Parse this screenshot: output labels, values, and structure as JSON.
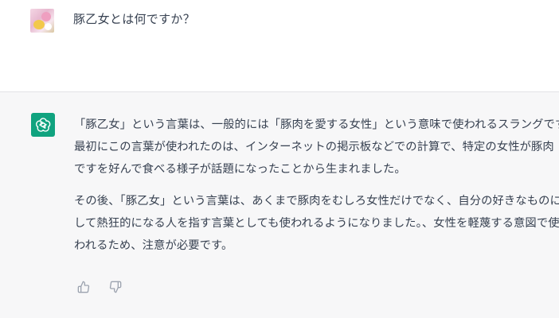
{
  "user_message": {
    "text": "豚乙女とは何ですか？"
  },
  "assistant_message": {
    "paragraphs": [
      {
        "lines": [
          "「豚乙女」という言葉は、一般的には「豚肉を愛する女性」という意味で使われるスラングです。",
          "最初にこの言葉が使われたのは、インターネットの掲示板などでの計算で、特定の女性が豚肉",
          "ですを好んで食べる様子が話題になったことから生まれました。"
        ]
      },
      {
        "lines": [
          "その後、「豚乙女」という言葉は、あくまで豚肉をむしろ女性だけでなく、自分の好きなものに対",
          "して熱狂的になる人を指す言葉としても使われるようになりました。、女性を軽蔑する意図で使",
          "われるため、注意が必要です。"
        ]
      }
    ]
  },
  "feedback": {
    "thumbs_up_icon": "thumbs-up-icon",
    "thumbs_down_icon": "thumbs-down-icon"
  },
  "colors": {
    "assistant_bg": "#f7f7f8",
    "gpt_avatar": "#10a37f",
    "text": "#374151"
  }
}
